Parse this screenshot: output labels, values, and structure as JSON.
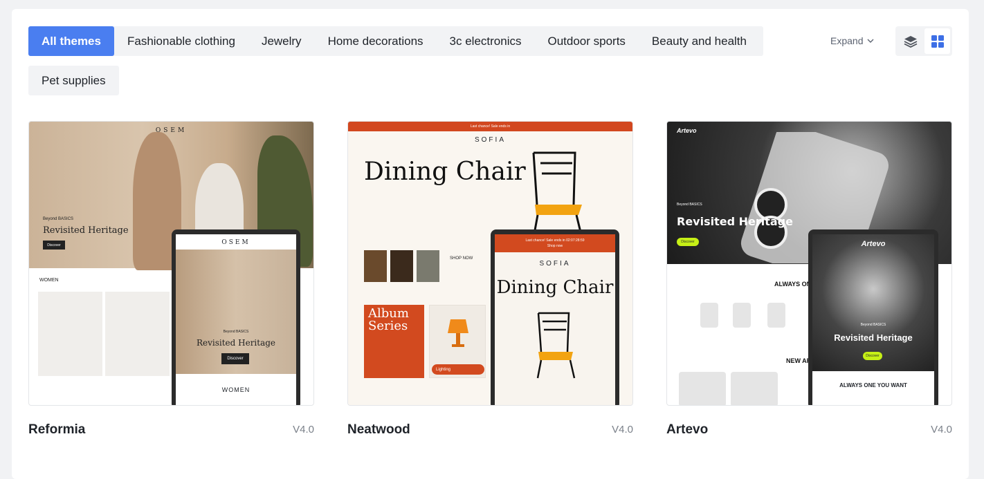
{
  "categories": {
    "tabs": [
      {
        "label": "All themes",
        "active": true
      },
      {
        "label": "Fashionable clothing",
        "active": false
      },
      {
        "label": "Jewelry",
        "active": false
      },
      {
        "label": "Home decorations",
        "active": false
      },
      {
        "label": "3c electronics",
        "active": false
      },
      {
        "label": "Outdoor sports",
        "active": false
      },
      {
        "label": "Beauty and health",
        "active": false
      },
      {
        "label": "Pet supplies",
        "active": false
      }
    ],
    "expand_label": "Expand"
  },
  "view_toggle": {
    "options": [
      {
        "icon": "layers-icon",
        "active": false
      },
      {
        "icon": "grid-icon",
        "active": true
      }
    ],
    "active_color": "#3d6fe6"
  },
  "themes": [
    {
      "name": "Reformia",
      "version": "V4.0",
      "preview": {
        "logo": "OSEM",
        "subtitle": "Beyond BASICS",
        "headline": "Revisited Heritage",
        "button": "Discover",
        "section": "WOMEN"
      }
    },
    {
      "name": "Neatwood",
      "version": "V4.0",
      "preview": {
        "banner": "Last chance! Sale ends in",
        "logo": "SOFIA",
        "headline": "Dining Chair",
        "album": "Album Series",
        "shop_now": "SHOP NOW",
        "lighting": "Lighting",
        "phone_banner": "Last chance! Sale ends in 02:07:28:59",
        "phone_shop": "Shop now"
      }
    },
    {
      "name": "Artevo",
      "version": "V4.0",
      "preview": {
        "logo": "Artevo",
        "subtitle": "Beyond BASICS",
        "headline": "Revisited Heritage",
        "button": "Discover",
        "always": "ALWAYS ONE YOU WANT",
        "new_arrivals": "NEW AR"
      }
    }
  ],
  "colors": {
    "accent": "#4a7ef0",
    "neatwood_orange": "#d2471f",
    "artevo_lime": "#c6f016"
  }
}
